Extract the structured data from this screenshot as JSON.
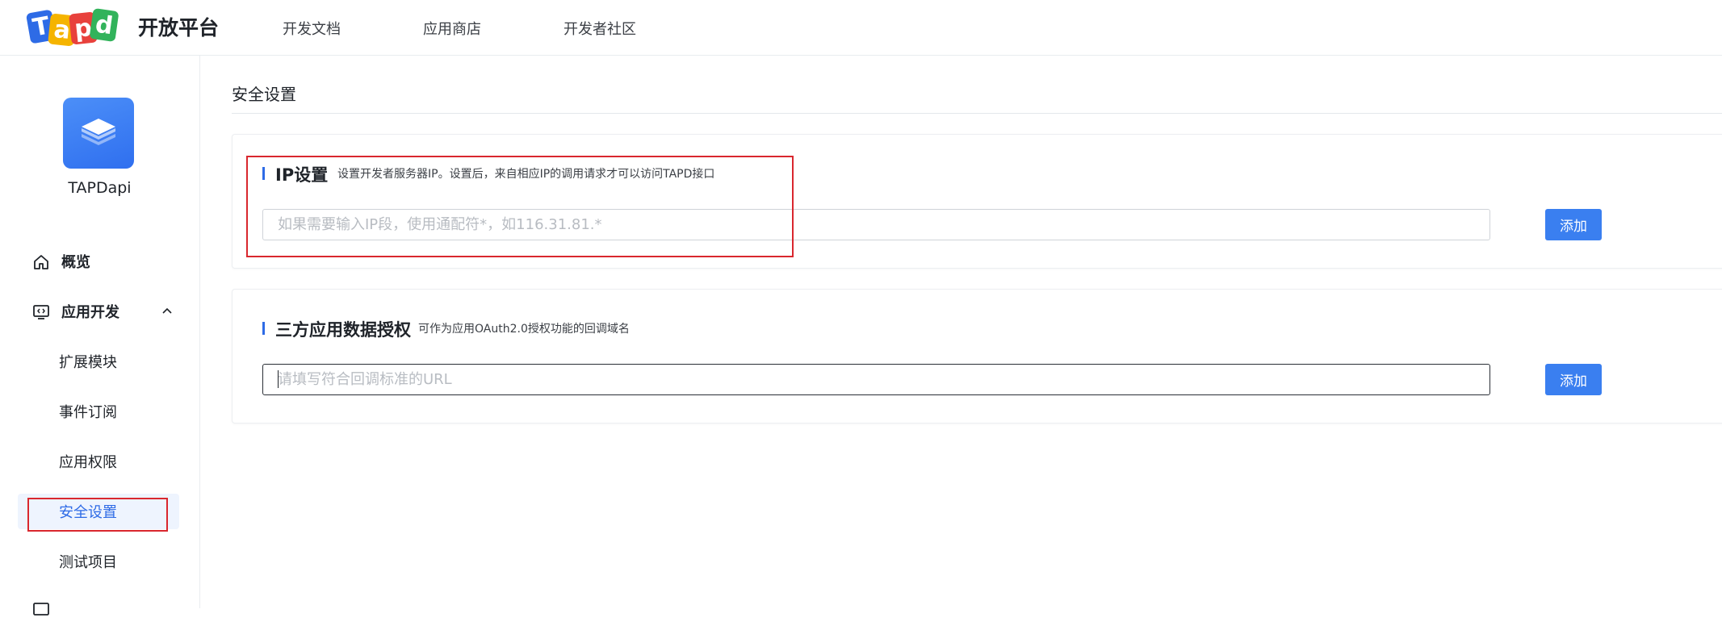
{
  "header": {
    "logo_letters": [
      "T",
      "a",
      "p",
      "d"
    ],
    "brand": "开放平台",
    "nav": [
      "开发文档",
      "应用商店",
      "开发者社区"
    ]
  },
  "sidebar": {
    "app_name": "TAPDapi",
    "menu": [
      {
        "label": "概览",
        "icon": "home-icon"
      },
      {
        "label": "应用开发",
        "icon": "code-window-icon",
        "expanded": true
      }
    ],
    "sub_items": [
      "扩展模块",
      "事件订阅",
      "应用权限",
      "安全设置",
      "测试项目"
    ],
    "active_sub": "安全设置"
  },
  "main": {
    "page_title": "安全设置",
    "ip_section": {
      "title": "IP设置",
      "description": "设置开发者服务器IP。设置后，来自相应IP的调用请求才可以访问TAPD接口",
      "placeholder": "如果需要输入IP段，使用通配符*，如116.31.81.*",
      "value": "",
      "button": "添加"
    },
    "oauth_section": {
      "title": "三方应用数据授权",
      "description": "可作为应用OAuth2.0授权功能的回调域名",
      "placeholder": "请填写符合回调标准的URL",
      "value": "",
      "button": "添加"
    }
  },
  "colors": {
    "accent": "#2e6be6",
    "button": "#3a7ff0",
    "highlight_outline": "#d9272e",
    "active_bg": "#eef4fe"
  }
}
